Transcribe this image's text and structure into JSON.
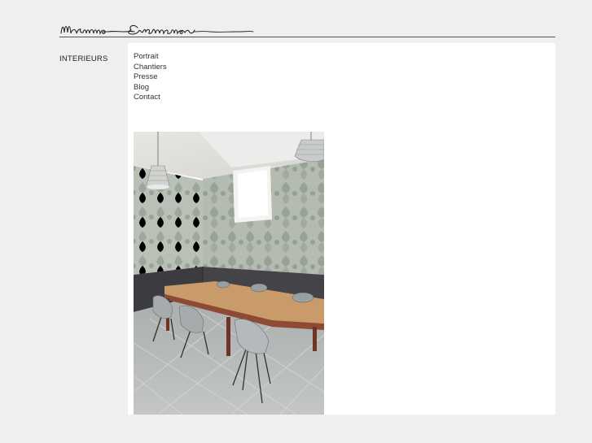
{
  "logo": {
    "text": "Marianne Evennou",
    "icon": "signature-logo"
  },
  "section": {
    "title": "INTERIEURS"
  },
  "nav": {
    "items": [
      {
        "label": "Portrait"
      },
      {
        "label": "Chantiers"
      },
      {
        "label": "Presse"
      },
      {
        "label": "Blog"
      },
      {
        "label": "Contact"
      }
    ]
  },
  "photo": {
    "subject": "dining-room-photo"
  },
  "colors": {
    "page_background": "#efefef",
    "panel_background": "#ffffff",
    "rule": "#555555",
    "text": "#333333"
  }
}
